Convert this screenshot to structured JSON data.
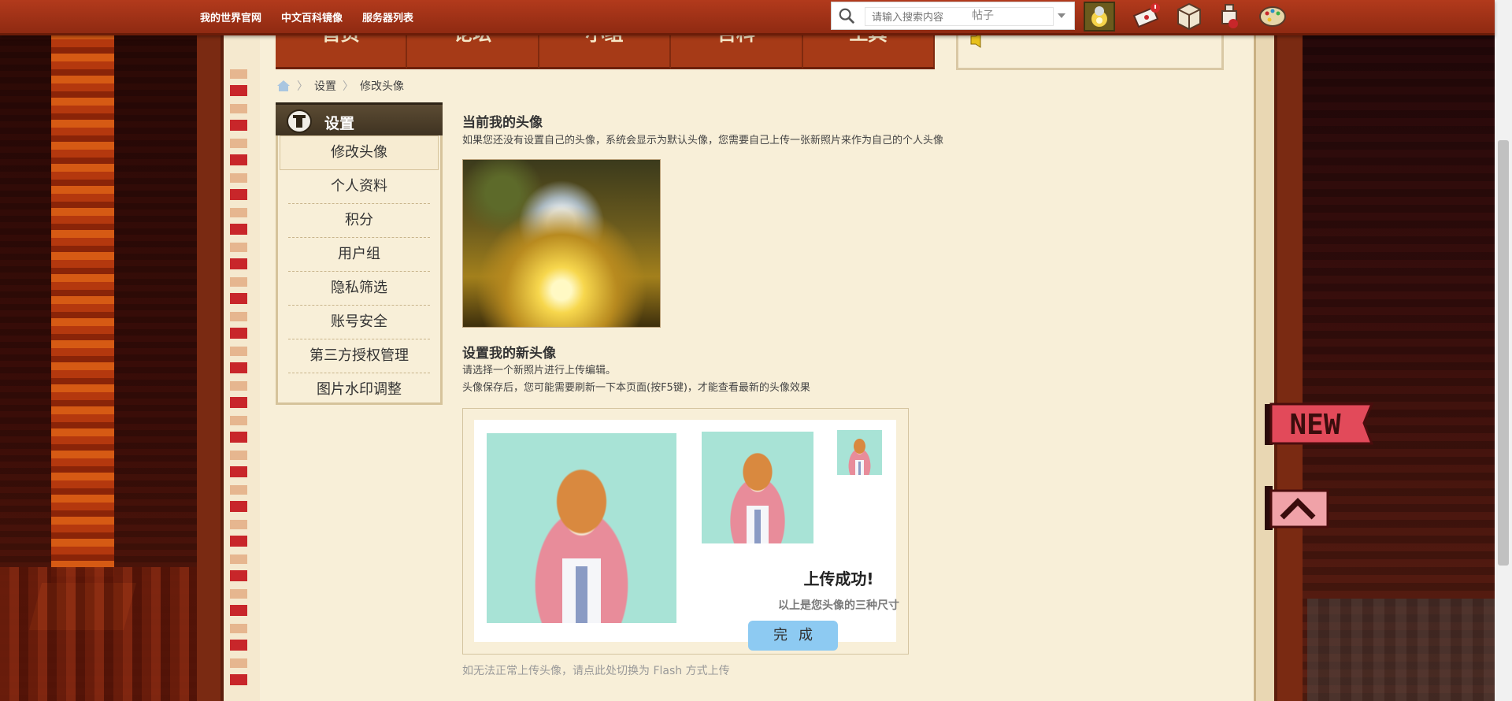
{
  "topbar": {
    "links": [
      "我的世界官网",
      "中文百科镜像",
      "服务器列表"
    ],
    "search_placeholder": "请输入搜索内容",
    "search_type": "帖子"
  },
  "nav": {
    "tabs": [
      "首页",
      "论坛",
      "小组",
      "百科",
      "工具"
    ]
  },
  "breadcrumb": {
    "items": [
      "设置",
      "修改头像"
    ]
  },
  "sidebar": {
    "title": "设置",
    "items": [
      "修改头像",
      "个人资料",
      "积分",
      "用户组",
      "隐私筛选",
      "账号安全",
      "第三方授权管理",
      "图片水印调整"
    ]
  },
  "main": {
    "current_title": "当前我的头像",
    "current_desc": "如果您还没有设置自己的头像，系统会显示为默认头像，您需要自己上传一张新照片来作为自己的个人头像",
    "new_title": "设置我的新头像",
    "new_desc1": "请选择一个新照片进行上传编辑。",
    "new_desc2": "头像保存后，您可能需要刷新一下本页面(按F5键)，才能查看最新的头像效果",
    "upload_success": "上传成功!",
    "upload_sizes": "以上是您头像的三种尺寸",
    "done_label": "完成",
    "flash_link": "如无法正常上传头像，请点此处切换为 Flash 方式上传"
  },
  "widgets": {
    "new_badge": "NEW"
  },
  "colors": {
    "topbar": "#a8351a",
    "navtab": "#a63a17",
    "page": "#f8efd8",
    "done_button": "#8dcaf2"
  }
}
